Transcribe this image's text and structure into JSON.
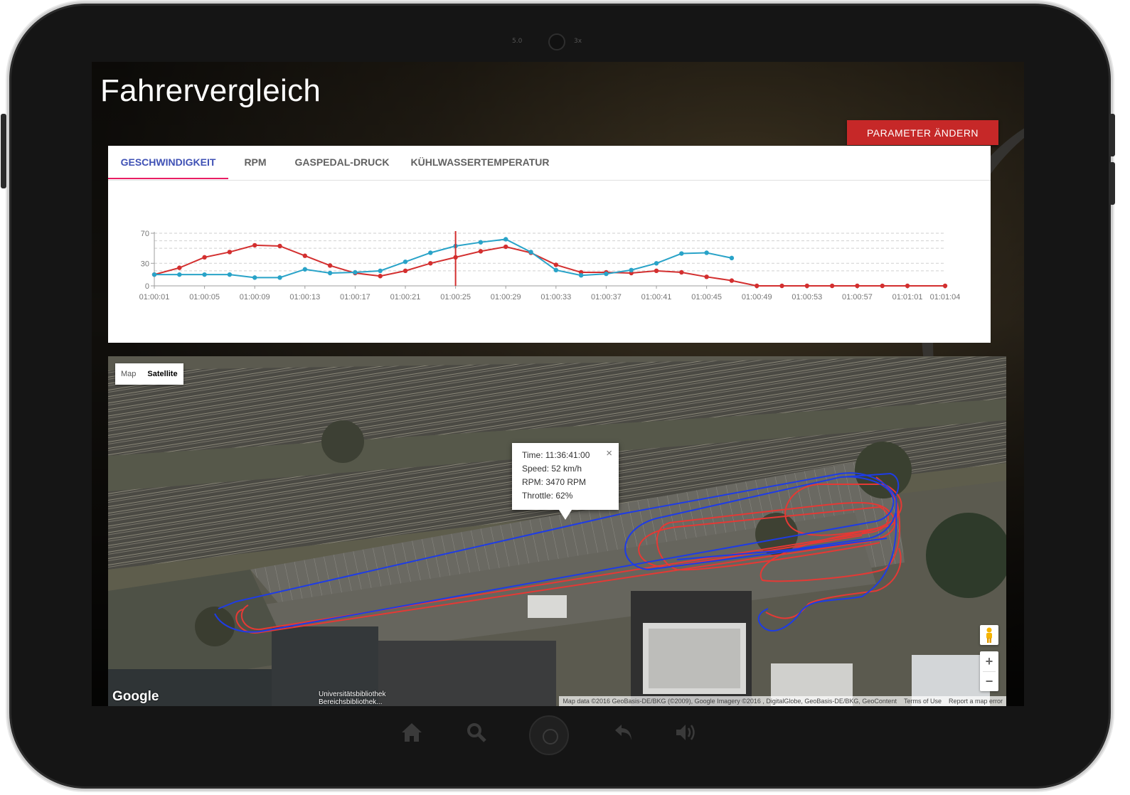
{
  "device": {
    "camera_label_left": "5.0",
    "camera_label_right": "3x"
  },
  "page": {
    "title": "Fahrervergleich",
    "param_button_label": "PARAMETER ÄNDERN"
  },
  "tabs": [
    {
      "label": "GESCHWINDIGKEIT",
      "active": true
    },
    {
      "label": "RPM",
      "active": false
    },
    {
      "label": "GASPEDAL-DRUCK",
      "active": false
    },
    {
      "label": "KÜHLWASSERTEMPERATUR",
      "active": false
    }
  ],
  "chart_data": {
    "type": "line",
    "x": [
      "01:00:01",
      "01:00:03",
      "01:00:05",
      "01:00:07",
      "01:00:09",
      "01:00:11",
      "01:00:13",
      "01:00:15",
      "01:00:17",
      "01:00:19",
      "01:00:21",
      "01:00:23",
      "01:00:25",
      "01:00:27",
      "01:00:29",
      "01:00:31",
      "01:00:33",
      "01:00:35",
      "01:00:37",
      "01:00:39",
      "01:00:41",
      "01:00:43",
      "01:00:45",
      "01:00:47",
      "01:00:49",
      "01:00:51",
      "01:00:53",
      "01:00:55",
      "01:00:57",
      "01:00:59",
      "01:01:01",
      "01:01:04"
    ],
    "x_tick_labels": [
      "01:00:01",
      "01:00:05",
      "01:00:09",
      "01:00:13",
      "01:00:17",
      "01:00:21",
      "01:00:25",
      "01:00:29",
      "01:00:33",
      "01:00:37",
      "01:00:41",
      "01:00:45",
      "01:00:49",
      "01:00:53",
      "01:00:57",
      "01:01:01",
      "01:01:04"
    ],
    "y_tick_labels": [
      "0",
      "30",
      "70"
    ],
    "ylim": [
      0,
      70
    ],
    "series": [
      {
        "color": "#d32f2f",
        "values": [
          15,
          24,
          38,
          45,
          54,
          53,
          40,
          27,
          17,
          13,
          20,
          30,
          38,
          46,
          52,
          44,
          28,
          18,
          18,
          17,
          20,
          18,
          12,
          7,
          0,
          0,
          0,
          0,
          0,
          0,
          0,
          0
        ]
      },
      {
        "color": "#29a3c8",
        "values": [
          15,
          15,
          15,
          15,
          11,
          11,
          22,
          17,
          18,
          20,
          32,
          44,
          53,
          58,
          62,
          45,
          21,
          14,
          16,
          21,
          30,
          43,
          44,
          37,
          null,
          null,
          null,
          null,
          null,
          null,
          null,
          null
        ]
      }
    ],
    "marker_x": "01:00:25",
    "marker_color": "#d32f2f",
    "grid": "dashed horizontal"
  },
  "map": {
    "type_buttons": [
      "Map",
      "Satellite"
    ],
    "selected_type": "Satellite",
    "infowindow": {
      "lines": [
        "Time: 11:36:41:00",
        "Speed: 52 km/h",
        "RPM: 3470 RPM",
        "Throttle: 62%"
      ],
      "close": "×"
    },
    "zoom_in": "+",
    "zoom_out": "−",
    "logo": "Google",
    "poi_label_1": "Universitätsbibliothek",
    "poi_label_2": "Bereichsbibliothek...",
    "attribution": "Map data ©2016 GeoBasis-DE/BKG (©2009), Google Imagery ©2016 , DigitalGlobe, GeoBasis-DE/BKG, GeoContent",
    "terms": "Terms of Use",
    "report": "Report a map error",
    "track_colors": [
      "#e53935",
      "#1e3ce6"
    ]
  },
  "navbar_icons": [
    "home-icon",
    "search-icon",
    "back-icon",
    "volume-icon"
  ]
}
